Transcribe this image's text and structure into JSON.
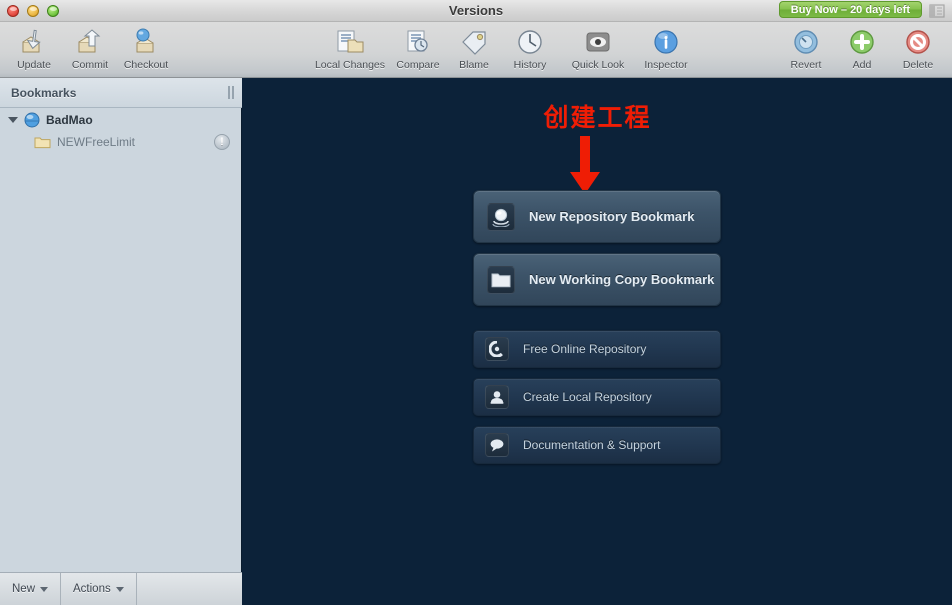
{
  "window": {
    "title": "Versions",
    "traffic_lights": [
      "close",
      "minimize",
      "zoom"
    ]
  },
  "purchase_badge": {
    "label": "Buy Now – 20 days left",
    "color": "#86c24e"
  },
  "toolbar": {
    "left_items": [
      {
        "label": "Update",
        "icon": "update-icon"
      },
      {
        "label": "Commit",
        "icon": "commit-icon"
      },
      {
        "label": "Checkout",
        "icon": "checkout-icon"
      }
    ],
    "center_items": [
      {
        "label": "Local Changes",
        "icon": "local-changes-icon"
      },
      {
        "label": "Compare",
        "icon": "compare-icon"
      },
      {
        "label": "Blame",
        "icon": "blame-icon"
      },
      {
        "label": "History",
        "icon": "history-icon"
      },
      {
        "label": "Quick Look",
        "icon": "quick-look-icon"
      },
      {
        "label": "Inspector",
        "icon": "inspector-icon"
      }
    ],
    "right_items": [
      {
        "label": "Revert",
        "icon": "revert-icon"
      },
      {
        "label": "Add",
        "icon": "add-icon"
      },
      {
        "label": "Delete",
        "icon": "delete-icon"
      }
    ],
    "toggle_icon": "toolbar-toggle-icon"
  },
  "sidebar": {
    "header": "Bookmarks",
    "grip_icon": "resize-grip-icon",
    "items": [
      {
        "label": "BadMao",
        "icon": "repository-globe-icon",
        "level": 1,
        "expanded": true,
        "badge": ""
      },
      {
        "label": "NEWFreeLimit",
        "icon": "folder-icon",
        "level": 2,
        "expanded": false,
        "badge": "!"
      }
    ],
    "footer": {
      "new_label": "New",
      "actions_label": "Actions"
    }
  },
  "main": {
    "annotation": {
      "text": "创建工程",
      "color": "#ef1d05",
      "arrow": "down-arrow-annotation"
    },
    "primary_buttons": [
      {
        "label": "New Repository Bookmark",
        "icon": "repository-globe-icon"
      },
      {
        "label": "New Working Copy Bookmark",
        "icon": "folder-icon"
      }
    ],
    "secondary_buttons": [
      {
        "label": "Free Online Repository",
        "icon": "beanstalk-icon"
      },
      {
        "label": "Create Local Repository",
        "icon": "local-disk-icon"
      },
      {
        "label": "Documentation & Support",
        "icon": "speech-bubble-icon"
      }
    ],
    "background_color": "#0c2239"
  }
}
